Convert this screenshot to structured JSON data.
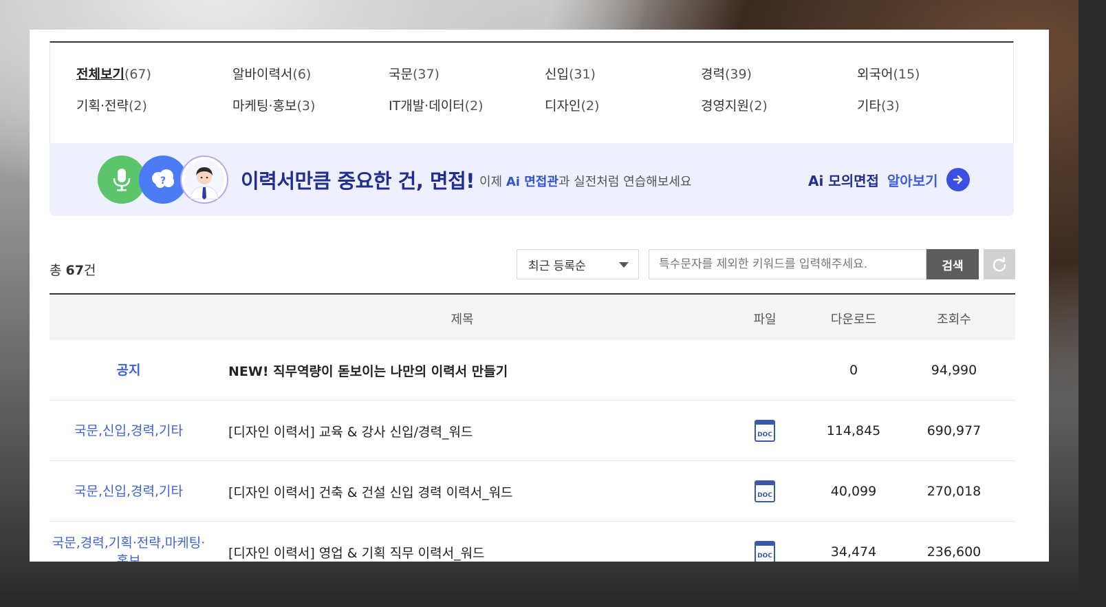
{
  "categories": [
    {
      "label": "전체보기",
      "count": "(67)",
      "active": true
    },
    {
      "label": "알바이력서",
      "count": "(6)"
    },
    {
      "label": "국문",
      "count": "(37)"
    },
    {
      "label": "신입",
      "count": "(31)"
    },
    {
      "label": "경력",
      "count": "(39)"
    },
    {
      "label": "외국어",
      "count": "(15)"
    },
    {
      "label": "기획·전략",
      "count": "(2)"
    },
    {
      "label": "마케팅·홍보",
      "count": "(3)"
    },
    {
      "label": "IT개발·데이터",
      "count": "(2)"
    },
    {
      "label": "디자인",
      "count": "(2)"
    },
    {
      "label": "경영지원",
      "count": "(2)"
    },
    {
      "label": "기타",
      "count": "(3)"
    }
  ],
  "banner": {
    "title": "이력서만큼 중요한 건, 면접!",
    "sub_prefix": "이제 ",
    "sub_highlight": "Ai 면접관",
    "sub_suffix": "과 실전처럼 연습해보세요",
    "link_main": "Ai 모의면접",
    "link_more": "알아보기",
    "icons": [
      "microphone-icon",
      "question-bubble-icon",
      "interviewer-avatar-icon",
      "arrow-right-icon"
    ]
  },
  "toolbar": {
    "total_prefix": "총 ",
    "total_count": "67",
    "total_suffix": "건",
    "sort_selected": "최근 등록순",
    "search_placeholder": "특수문자를 제외한 키워드를 입력해주세요.",
    "search_button": "검색",
    "reset_icon": "refresh-icon"
  },
  "table": {
    "headers": {
      "category": "",
      "title": "제목",
      "file": "파일",
      "downloads": "다운로드",
      "views": "조회수"
    },
    "rows": [
      {
        "category": "공지",
        "title": "NEW! 직무역량이 돋보이는 나만의 이력서 만들기",
        "file": "",
        "downloads": "0",
        "views": "94,990"
      },
      {
        "category": "국문,신입,경력,기타",
        "title": "[디자인 이력서] 교육 & 강사 신입/경력_워드",
        "file": "DOC",
        "downloads": "114,845",
        "views": "690,977"
      },
      {
        "category": "국문,신입,경력,기타",
        "title": "[디자인 이력서] 건축 & 건설 신입 경력 이력서_워드",
        "file": "DOC",
        "downloads": "40,099",
        "views": "270,018"
      },
      {
        "category": "국문,경력,기획·전략,마케팅·홍보",
        "title": "[디자인 이력서] 영업 & 기획 직무 이력서_워드",
        "file": "DOC",
        "downloads": "34,474",
        "views": "236,600"
      }
    ]
  },
  "colors": {
    "accent": "#3f63d6",
    "banner_bg": "#eef1fd",
    "banner_title": "#1f2e8f",
    "search_btn": "#5d5d5d"
  }
}
